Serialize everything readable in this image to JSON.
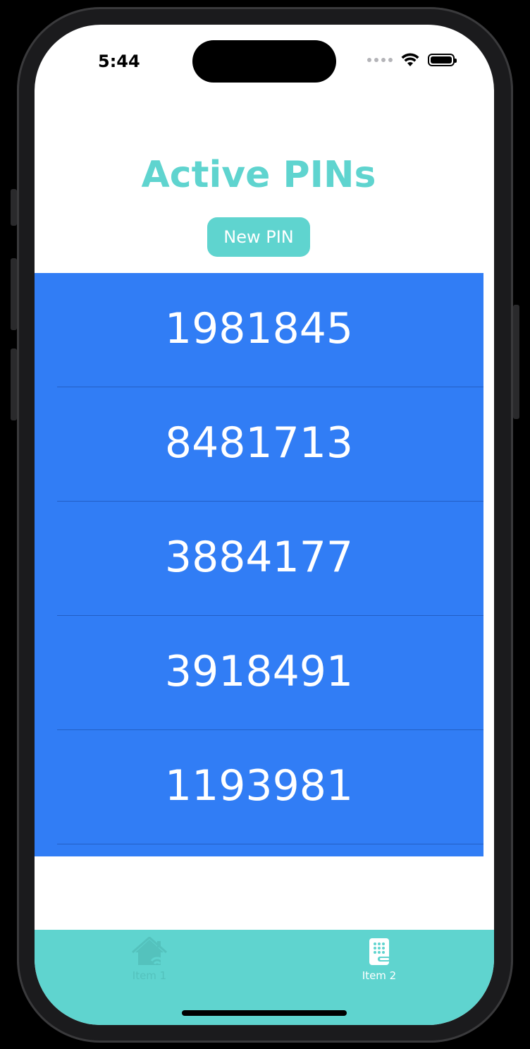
{
  "status_bar": {
    "time": "5:44",
    "icons": [
      "signal-dots-icon",
      "wifi-icon",
      "battery-icon"
    ]
  },
  "header": {
    "title": "Active PINs",
    "new_pin_label": "New PIN"
  },
  "pins": [
    "1981845",
    "8481713",
    "3884177",
    "3918491",
    "1193981"
  ],
  "tabbar": {
    "items": [
      {
        "label": "Item 1",
        "icon": "home-wifi-icon",
        "selected": false
      },
      {
        "label": "Item 2",
        "icon": "keypad-lock-icon",
        "selected": true
      }
    ]
  },
  "colors": {
    "accent": "#5fd4cf",
    "list_background": "#317df5",
    "tab_inactive": "#54c2bd",
    "tab_active": "#ffffff"
  }
}
